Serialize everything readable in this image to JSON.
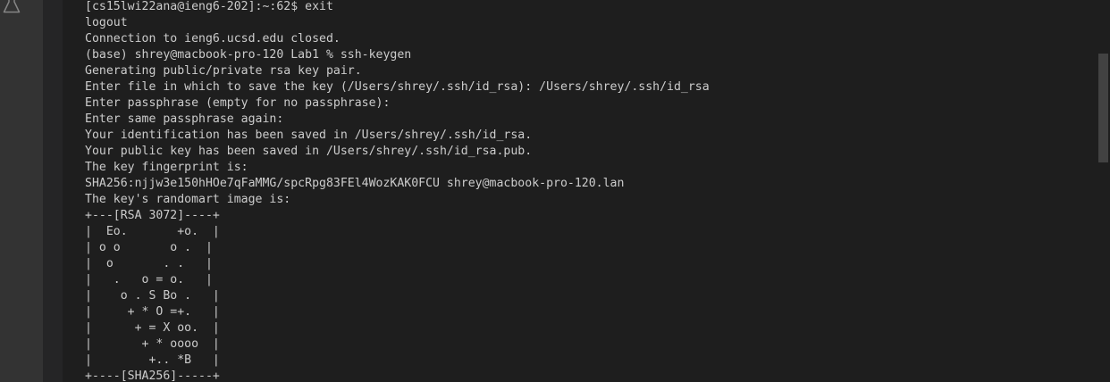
{
  "colors": {
    "background": "#1e1e1e",
    "text": "#cccccc",
    "activity_bar": "#333333",
    "scrollbar_thumb": "#424242"
  },
  "activity_bar": {
    "icon": "flask-icon"
  },
  "terminal": {
    "lines": [
      "[cs15lwi22ana@ieng6-202]:~:62$ exit",
      "logout",
      "Connection to ieng6.ucsd.edu closed.",
      "(base) shrey@macbook-pro-120 Lab1 % ssh-keygen",
      "Generating public/private rsa key pair.",
      "Enter file in which to save the key (/Users/shrey/.ssh/id_rsa): /Users/shrey/.ssh/id_rsa",
      "Enter passphrase (empty for no passphrase):",
      "Enter same passphrase again:",
      "Your identification has been saved in /Users/shrey/.ssh/id_rsa.",
      "Your public key has been saved in /Users/shrey/.ssh/id_rsa.pub.",
      "The key fingerprint is:",
      "SHA256:njjw3e150hHOe7qFaMMG/spcRpg83FEl4WozKAK0FCU shrey@macbook-pro-120.lan",
      "The key's randomart image is:",
      "+---[RSA 3072]----+",
      "|  Eo.       +o.  |",
      "| o o       o .  |",
      "|  o       . .   |",
      "|   .   o = o.   |",
      "|    o . S Bo .   |",
      "|     + * O =+.   |",
      "|      + = X oo.  |",
      "|       + * oooo  |",
      "|        +.. *B   |",
      "+----[SHA256]-----+"
    ]
  }
}
